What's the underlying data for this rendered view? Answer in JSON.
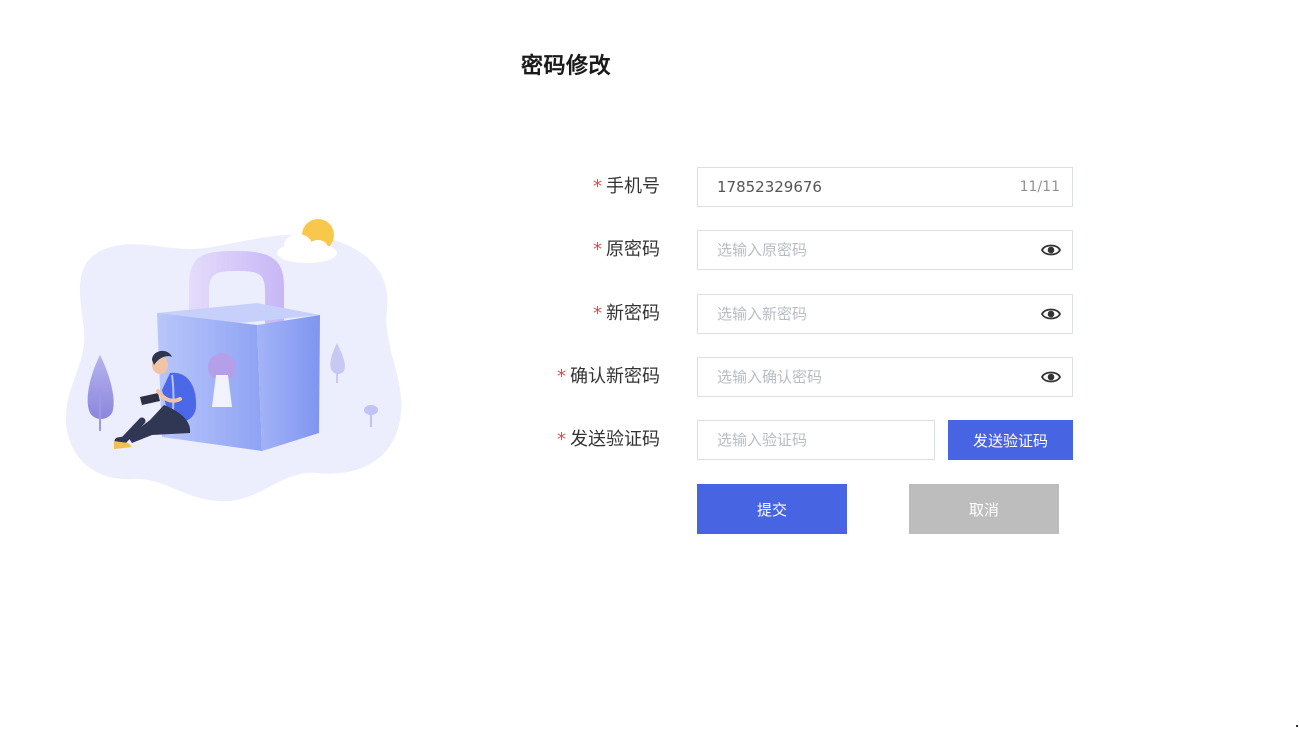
{
  "page": {
    "title": "密码修改"
  },
  "form": {
    "required_mark": "*",
    "phone": {
      "label": "手机号",
      "value": "17852329676",
      "counter": "11/11"
    },
    "old_password": {
      "label": "原密码",
      "placeholder": "选输入原密码",
      "icon": "eye-icon"
    },
    "new_password": {
      "label": "新密码",
      "placeholder": "选输入新密码",
      "icon": "eye-icon"
    },
    "confirm_password": {
      "label": "确认新密码",
      "placeholder": "选输入确认密码",
      "icon": "eye-icon"
    },
    "verify_code": {
      "label": "发送验证码",
      "placeholder": "选输入验证码",
      "send_button": "发送验证码"
    }
  },
  "actions": {
    "submit": "提交",
    "cancel": "取消"
  },
  "colors": {
    "primary": "#4764e3",
    "cancel": "#bdbdbd",
    "required": "#e54848",
    "illustration_bg": "#eceefd"
  }
}
